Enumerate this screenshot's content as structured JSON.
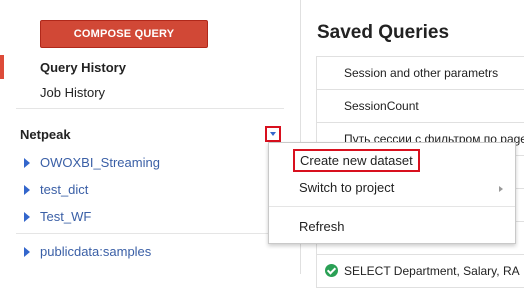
{
  "sidebar": {
    "compose_label": "COMPOSE QUERY",
    "nav": [
      {
        "label": "Query History"
      },
      {
        "label": "Job History"
      }
    ],
    "project": "Netpeak",
    "datasets": [
      {
        "label": "OWOXBI_Streaming"
      },
      {
        "label": "test_dict"
      },
      {
        "label": "Test_WF"
      }
    ],
    "public_dataset": "publicdata:samples"
  },
  "main": {
    "title": "Saved Queries",
    "rows": [
      {
        "label": "Session and other parametrs"
      },
      {
        "label": "SessionCount"
      },
      {
        "label": "Путь сессии с фильтром по page"
      },
      {
        "label": ""
      },
      {
        "label": ""
      },
      {
        "label": ""
      },
      {
        "label": "SELECT Department, Salary, RA"
      }
    ]
  },
  "context_menu": {
    "items": [
      {
        "label": "Create new dataset"
      },
      {
        "label": "Switch to project"
      },
      {
        "label": "Refresh"
      }
    ]
  },
  "colors": {
    "compose_button": "#d14836",
    "highlight_border": "#d8101e",
    "link": "#3a5fa6",
    "success": "#2aa055"
  },
  "icons": {
    "dataset_expand": "triangle-right-icon",
    "project_menu": "chevron-down-icon",
    "submenu": "triangle-right-icon",
    "query_status": "check-circle-icon"
  }
}
